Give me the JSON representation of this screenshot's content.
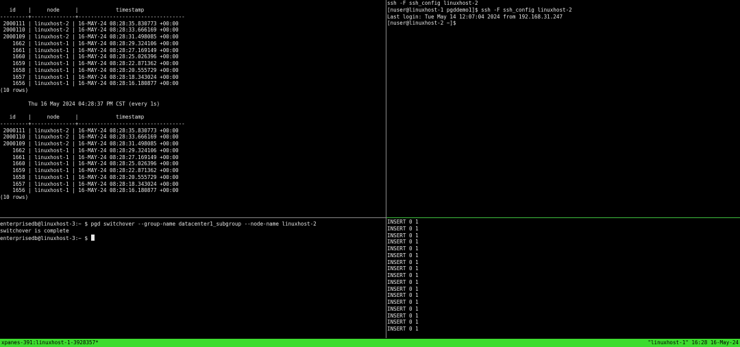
{
  "panes": {
    "top_left": {
      "lines": [
        "   id    |     node     |            timestamp",
        "---------+--------------+----------------------------------",
        " 2000111 | linuxhost-2 | 16-MAY-24 08:28:35.830773 +00:00",
        " 2000110 | linuxhost-2 | 16-MAY-24 08:28:33.666169 +00:00",
        " 2000109 | linuxhost-2 | 16-MAY-24 08:28:31.498085 +00:00",
        "    1662 | linuxhost-1 | 16-MAY-24 08:28:29.324106 +00:00",
        "    1661 | linuxhost-1 | 16-MAY-24 08:28:27.169149 +00:00",
        "    1660 | linuxhost-1 | 16-MAY-24 08:28:25.026396 +00:00",
        "    1659 | linuxhost-1 | 16-MAY-24 08:28:22.871362 +00:00",
        "    1658 | linuxhost-1 | 16-MAY-24 08:28:20.555729 +00:00",
        "    1657 | linuxhost-1 | 16-MAY-24 08:28:18.343024 +00:00",
        "    1656 | linuxhost-1 | 16-MAY-24 08:28:16.180877 +00:00",
        "(10 rows)",
        "",
        "         Thu 16 May 2024 04:28:37 PM CST (every 1s)",
        "",
        "   id    |     node     |            timestamp",
        "---------+--------------+----------------------------------",
        " 2000111 | linuxhost-2 | 16-MAY-24 08:28:35.830773 +00:00",
        " 2000110 | linuxhost-2 | 16-MAY-24 08:28:33.666169 +00:00",
        " 2000109 | linuxhost-2 | 16-MAY-24 08:28:31.498085 +00:00",
        "    1662 | linuxhost-1 | 16-MAY-24 08:28:29.324106 +00:00",
        "    1661 | linuxhost-1 | 16-MAY-24 08:28:27.169149 +00:00",
        "    1660 | linuxhost-1 | 16-MAY-24 08:28:25.026396 +00:00",
        "    1659 | linuxhost-1 | 16-MAY-24 08:28:22.871362 +00:00",
        "    1658 | linuxhost-1 | 16-MAY-24 08:28:20.555729 +00:00",
        "    1657 | linuxhost-1 | 16-MAY-24 08:28:18.343024 +00:00",
        "    1656 | linuxhost-1 | 16-MAY-24 08:28:16.180877 +00:00",
        "(10 rows)"
      ]
    },
    "top_right": {
      "lines": [
        "ssh -F ssh_config linuxhost-2",
        "[nuser@linuxhost-1 pgddemo1]$ ssh -F ssh_config linuxhost-2",
        "Last login: Tue May 14 12:07:04 2024 from 192.168.31.247",
        "[nuser@linuxhost-2 ~]$"
      ]
    },
    "bottom_left": {
      "lines": [
        "enterprisedb@linuxhost-3:~ $ pgd switchover --group-name datacenter1_subgroup --node-name linuxhost-2",
        "switchover is complete"
      ],
      "prompt": "enterprisedb@linuxhost-3:~ $ "
    },
    "bottom_right": {
      "lines": [
        "INSERT 0 1",
        "INSERT 0 1",
        "INSERT 0 1",
        "INSERT 0 1",
        "INSERT 0 1",
        "INSERT 0 1",
        "INSERT 0 1",
        "INSERT 0 1",
        "INSERT 0 1",
        "INSERT 0 1",
        "INSERT 0 1",
        "INSERT 0 1",
        "INSERT 0 1",
        "INSERT 0 1",
        "INSERT 0 1",
        "INSERT 0 1",
        "INSERT 0 1"
      ]
    }
  },
  "status_bar": {
    "left": "xpanes-391:linuxhost-1-3928357*",
    "right": "\"linuxhost-1\" 16:28 16-May-24"
  },
  "colors": {
    "background": "#000000",
    "text": "#e6e6e6",
    "status_bar": "#3ddc2e",
    "active_border": "#3fbf3f"
  }
}
